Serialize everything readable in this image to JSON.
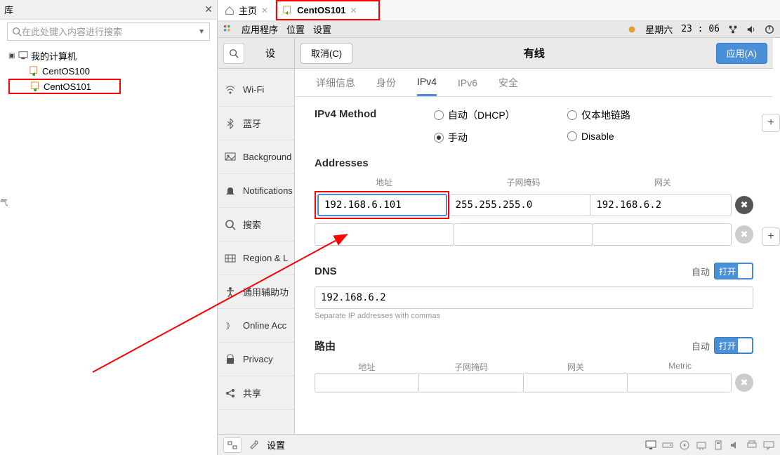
{
  "lib": {
    "title": "库",
    "search_placeholder": "在此处键入内容进行搜索",
    "root": "我的计算机",
    "items": [
      "CentOS100",
      "CentOS101"
    ]
  },
  "tabs": {
    "home": "主页",
    "vm": "CentOS101"
  },
  "gnome": {
    "apps": "应用程序",
    "places": "位置",
    "settings": "设置",
    "day": "星期六",
    "time": "23 : 06"
  },
  "settings_sidebar": {
    "search_placeholder": "设",
    "items": [
      {
        "icon": "wifi",
        "label": "Wi-Fi"
      },
      {
        "icon": "bt",
        "label": "蓝牙"
      },
      {
        "icon": "bg",
        "label": "Background"
      },
      {
        "icon": "bell",
        "label": "Notifications"
      },
      {
        "icon": "search",
        "label": "搜索"
      },
      {
        "icon": "region",
        "label": "Region & L"
      },
      {
        "icon": "access",
        "label": "通用辅助功"
      },
      {
        "icon": "online",
        "label": "Online Acc"
      },
      {
        "icon": "privacy",
        "label": "Privacy"
      },
      {
        "icon": "share",
        "label": "共享"
      }
    ]
  },
  "dialog": {
    "cancel": "取消(C)",
    "title": "有线",
    "apply": "应用(A)",
    "tabs": [
      "详细信息",
      "身份",
      "IPv4",
      "IPv6",
      "安全"
    ],
    "active_tab": "IPv4",
    "method_label": "IPv4 Method",
    "methods": {
      "auto": "自动（DHCP）",
      "manual": "手动",
      "linklocal": "仅本地链路",
      "disable": "Disable"
    },
    "addresses_label": "Addresses",
    "addr_headers": [
      "地址",
      "子网掩码",
      "网关"
    ],
    "addr_rows": [
      {
        "ip": "192.168.6.101",
        "mask": "255.255.255.0",
        "gw": "192.168.6.2"
      }
    ],
    "dns_label": "DNS",
    "auto_label": "自动",
    "switch_on": "打开",
    "dns_value": "192.168.6.2",
    "dns_hint": "Separate IP addresses with commas",
    "route_label": "路由",
    "route_headers": [
      "地址",
      "子网掩码",
      "网关",
      "Metric"
    ]
  },
  "statusbar": {
    "settings": "设置"
  },
  "left_gutter": "气"
}
